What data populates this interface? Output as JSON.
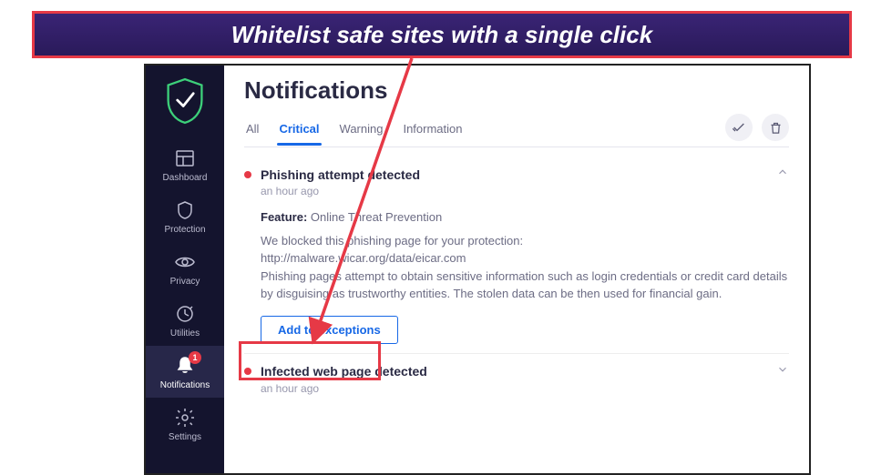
{
  "banner": {
    "text": "Whitelist safe sites with a single click"
  },
  "sidebar": {
    "items": [
      {
        "label": "Dashboard"
      },
      {
        "label": "Protection"
      },
      {
        "label": "Privacy"
      },
      {
        "label": "Utilities"
      },
      {
        "label": "Notifications",
        "badge": "1"
      },
      {
        "label": "Settings"
      }
    ]
  },
  "page": {
    "title": "Notifications",
    "tabs": [
      "All",
      "Critical",
      "Warning",
      "Information"
    ],
    "active_tab": 1
  },
  "notifications": [
    {
      "title": "Phishing attempt detected",
      "time": "an hour ago",
      "feature_label": "Feature:",
      "feature_value": "Online Threat Prevention",
      "desc_line1": "We blocked this phishing page for your protection:",
      "desc_line2": "http://malware.wicar.org/data/eicar.com",
      "desc_line3": "Phishing pages attempt to obtain sensitive information such as login credentials or credit card details by disguising as trustworthy entities. The stolen data can be then used for financial gain.",
      "button": "Add to exceptions",
      "expanded": true
    },
    {
      "title": "Infected web page detected",
      "time": "an hour ago",
      "expanded": false
    }
  ]
}
